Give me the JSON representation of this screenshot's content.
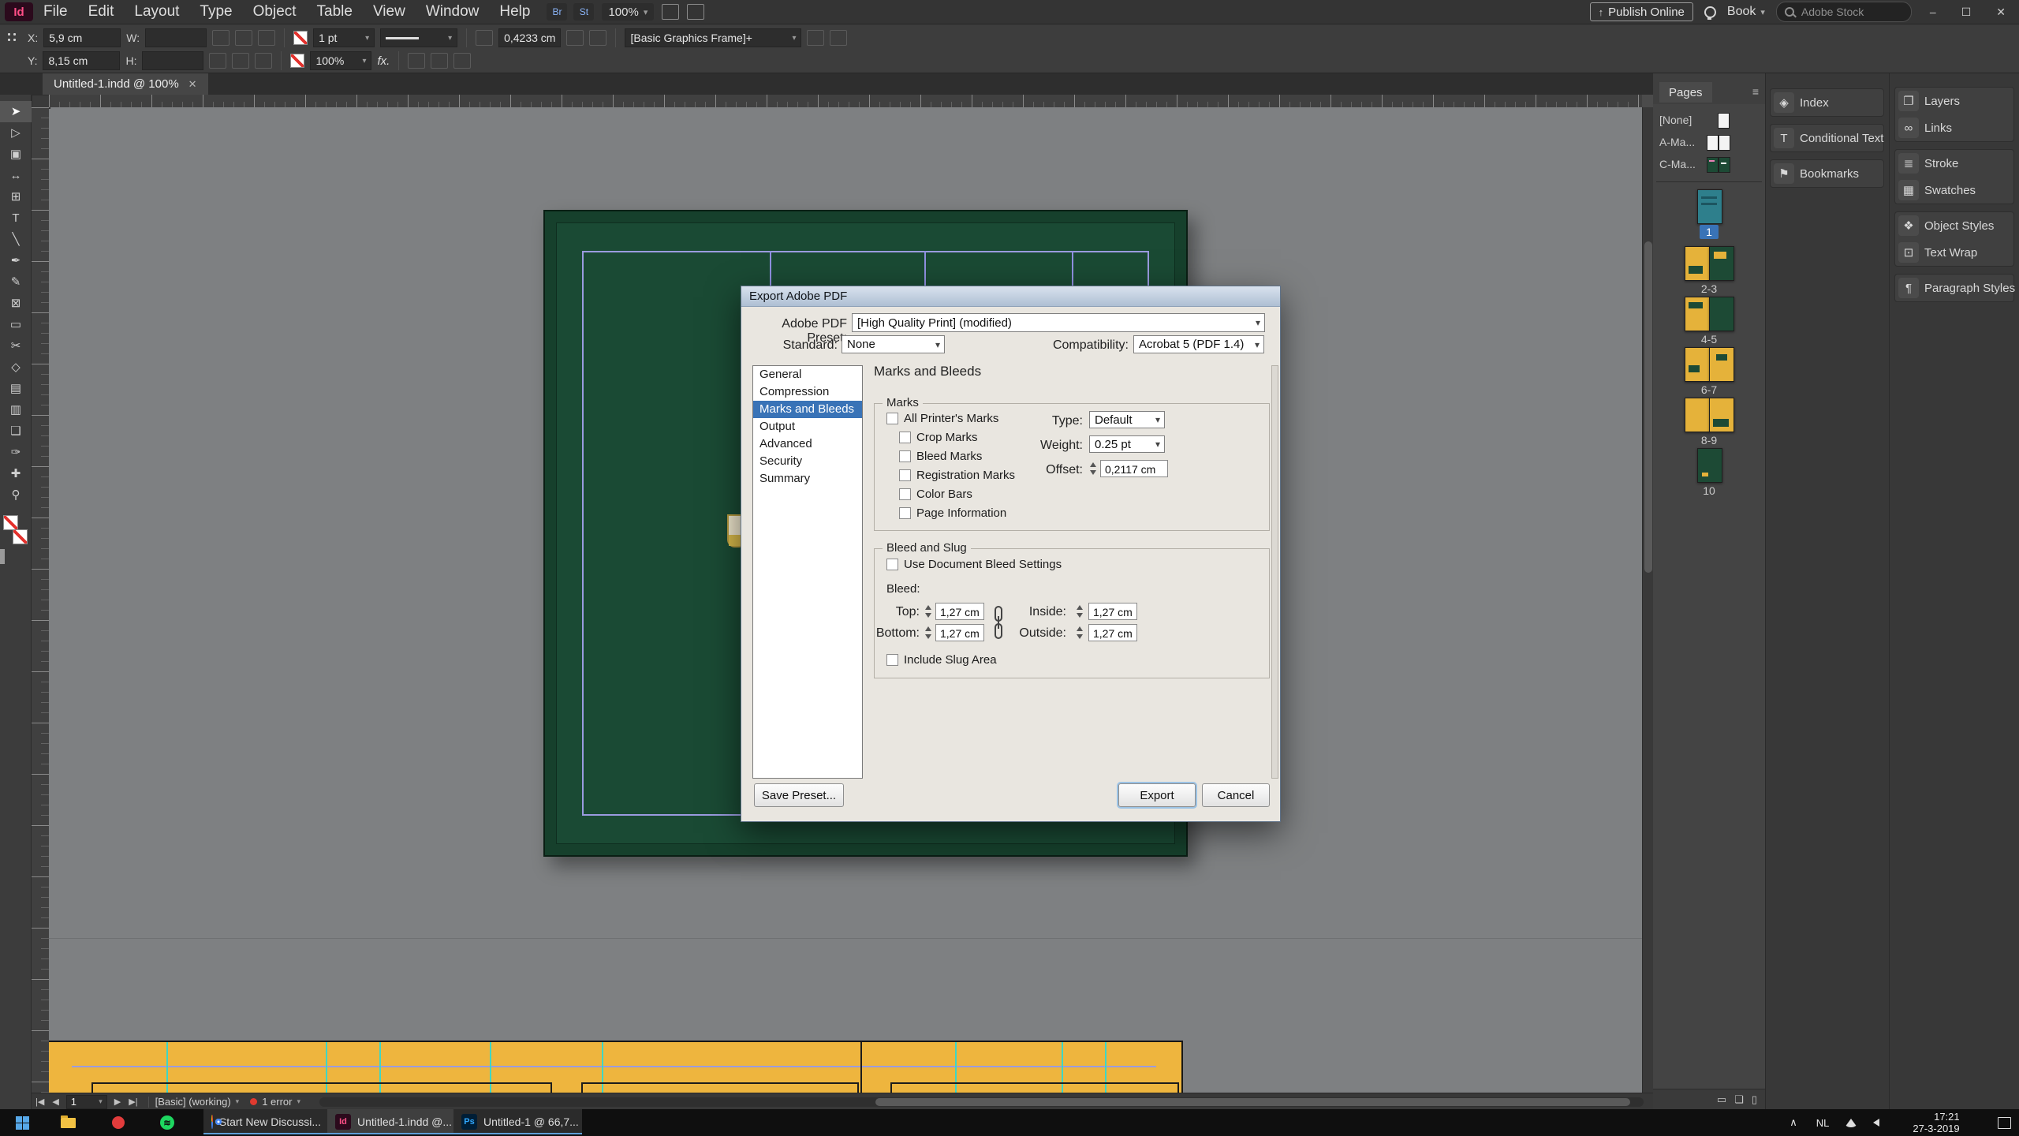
{
  "app": {
    "logo_text": "Id",
    "menus": [
      "File",
      "Edit",
      "Layout",
      "Type",
      "Object",
      "Table",
      "View",
      "Window",
      "Help"
    ],
    "toolbar_icons": [
      {
        "name": "bridge-icon",
        "glyph": "Br"
      },
      {
        "name": "stock-icon",
        "glyph": "St"
      }
    ],
    "zoom_level": "100%",
    "publish_online_label": "Publish Online",
    "book_label": "Book",
    "stock_search_placeholder": "Adobe Stock",
    "window_controls": [
      "–",
      "☐",
      "✕"
    ]
  },
  "control_bar": {
    "x_label": "X:",
    "x_value": "5,9 cm",
    "y_label": "Y:",
    "y_value": "8,15 cm",
    "w_label": "W:",
    "w_value": "",
    "h_label": "H:",
    "h_value": "",
    "stroke_weight_value": "1 pt",
    "stroke_scale_value": "100%",
    "corner_radius_value": "0,4233 cm",
    "fx_label": "fx.",
    "object_style_value": "[Basic Graphics Frame]+"
  },
  "document_tab": {
    "title": "Untitled-1.indd @ 100%",
    "close_glyph": "✕"
  },
  "tools": [
    {
      "name": "selection-tool",
      "glyph": "➤"
    },
    {
      "name": "direct-selection-tool",
      "glyph": "▷"
    },
    {
      "name": "page-tool",
      "glyph": "▣"
    },
    {
      "name": "gap-tool",
      "glyph": "↔"
    },
    {
      "name": "content-collector-tool",
      "glyph": "⊞"
    },
    {
      "name": "type-tool",
      "glyph": "T"
    },
    {
      "name": "line-tool",
      "glyph": "╲"
    },
    {
      "name": "pen-tool",
      "glyph": "✒"
    },
    {
      "name": "pencil-tool",
      "glyph": "✎"
    },
    {
      "name": "rectangle-frame-tool",
      "glyph": "⊠"
    },
    {
      "name": "rectangle-tool",
      "glyph": "▭"
    },
    {
      "name": "scissors-tool",
      "glyph": "✂"
    },
    {
      "name": "free-transform-tool",
      "glyph": "◇"
    },
    {
      "name": "gradient-tool",
      "glyph": "▤"
    },
    {
      "name": "gradient-feather-tool",
      "glyph": "▥"
    },
    {
      "name": "note-tool",
      "glyph": "❑"
    },
    {
      "name": "eyedropper-tool",
      "glyph": "✑"
    },
    {
      "name": "hand-tool",
      "glyph": "✚"
    },
    {
      "name": "zoom-tool",
      "glyph": "⚲"
    }
  ],
  "dialog": {
    "title": "Export Adobe PDF",
    "preset_label": "Adobe PDF Preset:",
    "preset_value": "[High Quality Print] (modified)",
    "standard_label": "Standard:",
    "standard_value": "None",
    "compatibility_label": "Compatibility:",
    "compatibility_value": "Acrobat 5 (PDF 1.4)",
    "sections": [
      "General",
      "Compression",
      "Marks and Bleeds",
      "Output",
      "Advanced",
      "Security",
      "Summary"
    ],
    "selected_section": "Marks and Bleeds",
    "panel_heading": "Marks and Bleeds",
    "marks_group": {
      "label": "Marks",
      "checkboxes": [
        "All Printer's Marks",
        "Crop Marks",
        "Bleed Marks",
        "Registration Marks",
        "Color Bars",
        "Page Information"
      ],
      "type_label": "Type:",
      "type_value": "Default",
      "weight_label": "Weight:",
      "weight_value": "0.25 pt",
      "offset_label": "Offset:",
      "offset_value": "0,2117 cm"
    },
    "bleed_group": {
      "label": "Bleed and Slug",
      "use_document_bleed_label": "Use Document Bleed Settings",
      "bleed_label": "Bleed:",
      "top_label": "Top:",
      "top_value": "1,27 cm",
      "bottom_label": "Bottom:",
      "bottom_value": "1,27 cm",
      "inside_label": "Inside:",
      "inside_value": "1,27 cm",
      "outside_label": "Outside:",
      "outside_value": "1,27 cm",
      "include_slug_label": "Include Slug Area"
    },
    "save_preset_button": "Save Preset...",
    "export_button": "Export",
    "cancel_button": "Cancel"
  },
  "pages_panel": {
    "tab_title": "Pages",
    "panel_menu_glyph": "≡",
    "masters": [
      {
        "label": "[None]"
      },
      {
        "label": "A-Ma..."
      },
      {
        "label": "C-Ma..."
      }
    ],
    "pages": [
      {
        "label": "1"
      },
      {
        "label": "2-3"
      },
      {
        "label": "4-5"
      },
      {
        "label": "6-7"
      },
      {
        "label": "8-9"
      },
      {
        "label": "10"
      }
    ],
    "footer_icons": [
      {
        "name": "page-size-button",
        "glyph": "▭"
      },
      {
        "name": "new-page-button",
        "glyph": "❏"
      },
      {
        "name": "delete-page-button",
        "glyph": "▯"
      }
    ]
  },
  "collapsed_panels": {
    "middle": [
      {
        "label": "Index",
        "glyph": "◈"
      },
      {
        "label": "Conditional Text",
        "glyph": "T"
      },
      {
        "label": "Bookmarks",
        "glyph": "⚑"
      }
    ],
    "right": [
      {
        "label": "Lay​ers",
        "glyph": "❐"
      },
      {
        "label": "Links",
        "glyph": "∞"
      },
      {
        "label": "Stroke",
        "glyph": "≣"
      },
      {
        "label": "Swatches",
        "glyph": "▦"
      },
      {
        "label": "Object Styles",
        "glyph": "❖"
      },
      {
        "label": "Text Wrap",
        "glyph": "⊡"
      },
      {
        "label": "Paragraph Styles",
        "glyph": "¶"
      }
    ]
  },
  "status_bar": {
    "nav_icons": [
      "|◀",
      "◀",
      "▶",
      "▶|"
    ],
    "page_value": "1",
    "preflight_label": "[Basic] (working)",
    "error_count_label": "1 error"
  },
  "taskbar": {
    "window_buttons": [
      {
        "label": "Start New Discussi..."
      },
      {
        "label": "Untitled-1.indd @..."
      },
      {
        "label": "Untitled-1 @ 66,7..."
      }
    ],
    "tray": {
      "language": "NL",
      "time": "17:21",
      "date": "27-3-2019"
    }
  },
  "colors": {
    "page_green": "#1a4a34",
    "page_yellow": "#eeb53e",
    "margin_guide": "#9a9bdf",
    "cyan_guide": "#3fd6c5",
    "selection_blue": "#3973b7",
    "error_red": "#e03a2f"
  }
}
